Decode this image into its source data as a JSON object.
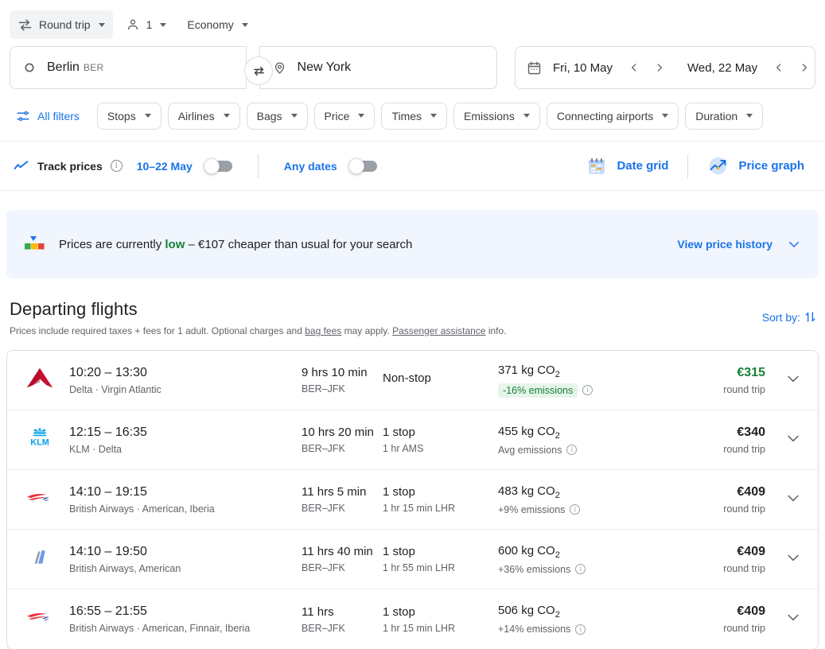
{
  "trip_controls": {
    "trip_type": "Round trip",
    "trip_type_icon": "swap-horizontal-icon",
    "passengers": "1",
    "passenger_icon": "person-icon",
    "cabin_class": "Economy"
  },
  "search": {
    "origin_city": "Berlin",
    "origin_code": "BER",
    "origin_icon": "circle-origin-icon",
    "destination_city": "New York",
    "destination_icon": "map-pin-icon",
    "swap_icon": "swap-arrows-icon",
    "calendar_icon": "calendar-icon",
    "depart_date": "Fri, 10 May",
    "return_date": "Wed, 22 May",
    "prev_icon": "chevron-left-icon",
    "next_icon": "chevron-right-icon"
  },
  "filters": {
    "all_filters_label": "All filters",
    "all_filters_icon": "tune-sliders-icon",
    "chips": [
      {
        "label": "Stops"
      },
      {
        "label": "Airlines"
      },
      {
        "label": "Bags"
      },
      {
        "label": "Price"
      },
      {
        "label": "Times"
      },
      {
        "label": "Emissions"
      },
      {
        "label": "Connecting airports"
      },
      {
        "label": "Duration"
      }
    ]
  },
  "track_bar": {
    "track_icon": "trend-line-icon",
    "track_label": "Track prices",
    "info_icon": "info-icon",
    "date_range_label": "10–22 May",
    "date_range_toggle_on": false,
    "any_dates_label": "Any dates",
    "any_dates_toggle_on": false,
    "date_grid_label": "Date grid",
    "date_grid_icon": "calendar-grid-icon",
    "price_graph_label": "Price graph",
    "price_graph_icon": "price-graph-icon"
  },
  "insight": {
    "icon": "price-gauge-icon",
    "text_before": "Prices are currently ",
    "highlight": "low",
    "text_after": " – €107 cheaper than usual for your search",
    "link_label": "View price history",
    "link_icon": "chevron-down-icon",
    "bg_color": "#f0f5fe",
    "highlight_color": "#188038"
  },
  "departing": {
    "title": "Departing flights",
    "subtitle_a": "Prices include required taxes + fees for 1 adult. Optional charges and ",
    "subtitle_link1": "bag fees",
    "subtitle_b": " may apply. ",
    "subtitle_link2": "Passenger assistance",
    "subtitle_c": " info.",
    "sort_label": "Sort by:",
    "sort_icon": "sort-arrows-icon"
  },
  "flights": [
    {
      "logo": "delta-logo",
      "times": "10:20 – 13:30",
      "airlines": "Delta · Virgin Atlantic",
      "duration": "9 hrs 10 min",
      "route": "BER–JFK",
      "stops": "Non-stop",
      "stop_detail": "",
      "co2": "371 kg CO",
      "co2_sub": "2",
      "emissions_note": "-16% emissions",
      "emissions_badge": true,
      "emissions_info_icon": "info-icon",
      "price": "€315",
      "price_green": true,
      "price_sub": "round trip",
      "expand_icon": "chevron-down-icon"
    },
    {
      "logo": "klm-logo",
      "times": "12:15 – 16:35",
      "airlines": "KLM · Delta",
      "duration": "10 hrs 20 min",
      "route": "BER–JFK",
      "stops": "1 stop",
      "stop_detail": "1 hr AMS",
      "co2": "455 kg CO",
      "co2_sub": "2",
      "emissions_note": "Avg emissions",
      "emissions_badge": false,
      "emissions_info_icon": "info-icon",
      "price": "€340",
      "price_green": false,
      "price_sub": "round trip",
      "expand_icon": "chevron-down-icon"
    },
    {
      "logo": "british-airways-logo",
      "times": "14:10 – 19:15",
      "airlines": "British Airways · American, Iberia",
      "duration": "11 hrs 5 min",
      "route": "BER–JFK",
      "stops": "1 stop",
      "stop_detail": "1 hr 15 min LHR",
      "co2": "483 kg CO",
      "co2_sub": "2",
      "emissions_note": "+9% emissions",
      "emissions_badge": false,
      "emissions_info_icon": "info-icon",
      "price": "€409",
      "price_green": false,
      "price_sub": "round trip",
      "expand_icon": "chevron-down-icon"
    },
    {
      "logo": "american-airlines-logo",
      "times": "14:10 – 19:50",
      "airlines": "British Airways, American",
      "duration": "11 hrs 40 min",
      "route": "BER–JFK",
      "stops": "1 stop",
      "stop_detail": "1 hr 55 min LHR",
      "co2": "600 kg CO",
      "co2_sub": "2",
      "emissions_note": "+36% emissions",
      "emissions_badge": false,
      "emissions_info_icon": "info-icon",
      "price": "€409",
      "price_green": false,
      "price_sub": "round trip",
      "expand_icon": "chevron-down-icon"
    },
    {
      "logo": "british-airways-logo",
      "times": "16:55 – 21:55",
      "airlines": "British Airways · American, Finnair, Iberia",
      "duration": "11 hrs",
      "route": "BER–JFK",
      "stops": "1 stop",
      "stop_detail": "1 hr 15 min LHR",
      "co2": "506 kg CO",
      "co2_sub": "2",
      "emissions_note": "+14% emissions",
      "emissions_badge": false,
      "emissions_info_icon": "info-icon",
      "price": "€409",
      "price_green": false,
      "price_sub": "round trip",
      "expand_icon": "chevron-down-icon"
    }
  ],
  "colors": {
    "accent_blue": "#1a73e8",
    "green": "#188038",
    "badge_bg": "#e6f4ea",
    "border": "#dadce0",
    "text_secondary": "#5f6368"
  }
}
